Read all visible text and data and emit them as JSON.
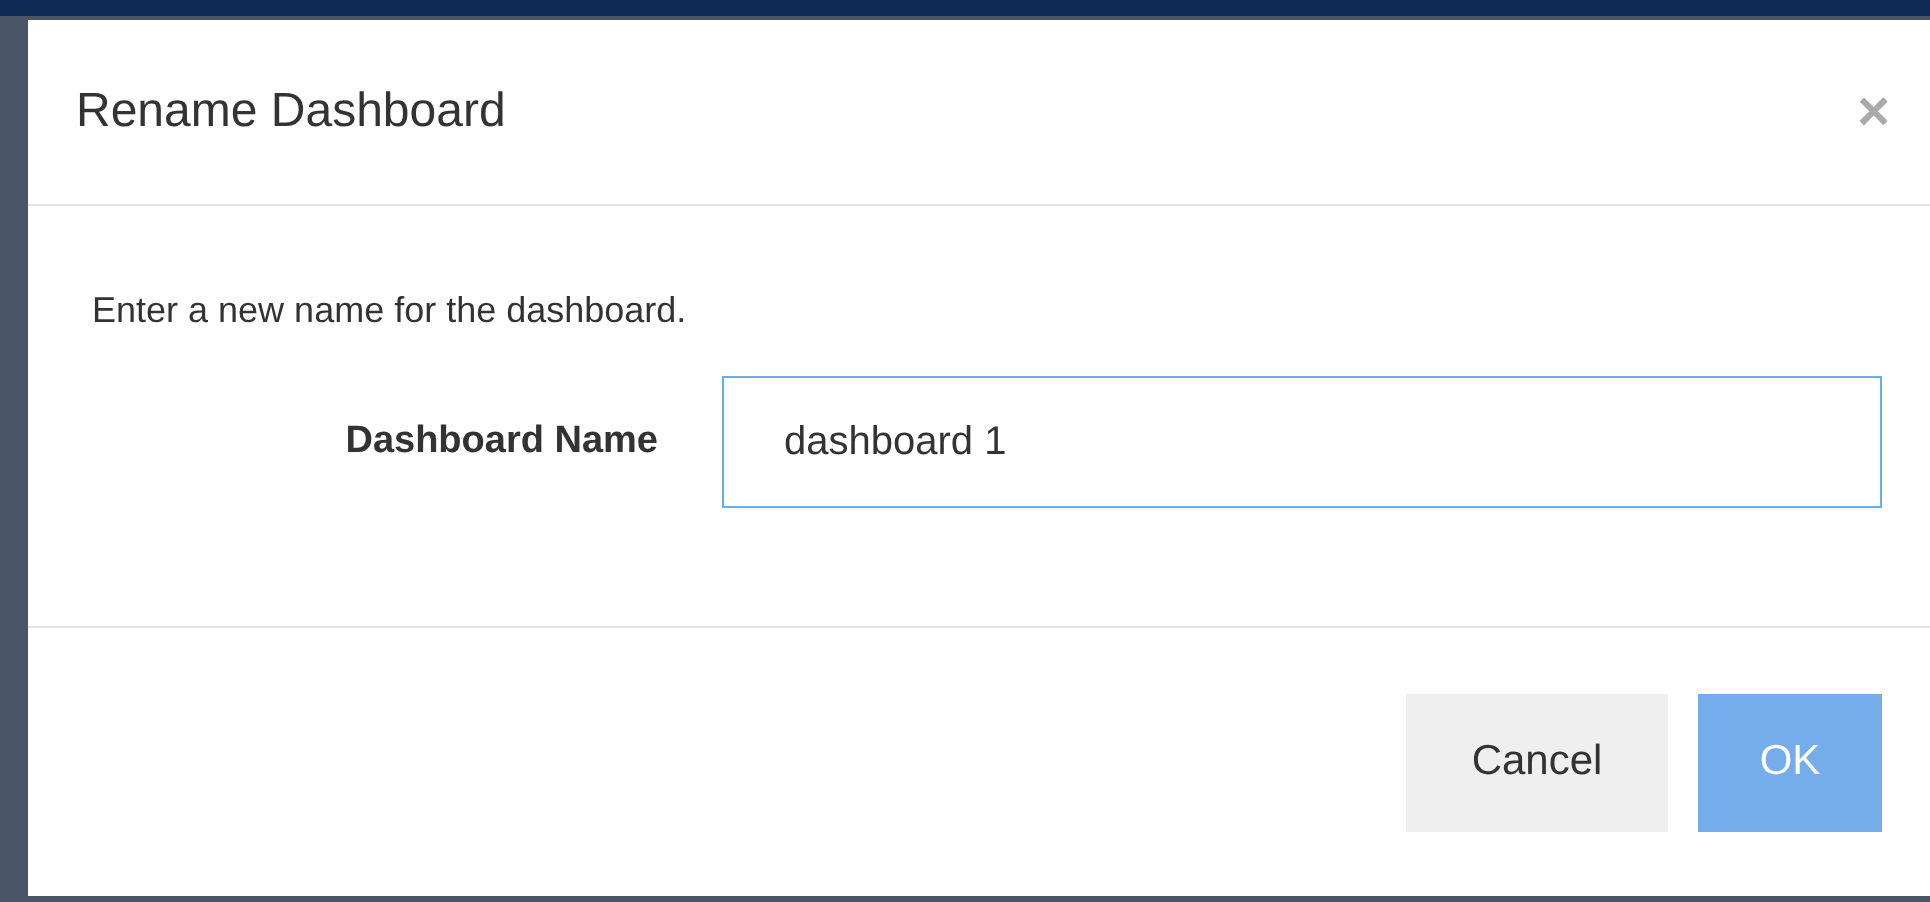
{
  "dialog": {
    "title": "Rename Dashboard",
    "close": "×",
    "message": "Enter a new name for the dashboard.",
    "field": {
      "label": "Dashboard Name",
      "value": "dashboard 1"
    },
    "buttons": [
      {
        "label": "Cancel",
        "kind": "secondary"
      },
      {
        "label": "OK",
        "kind": "primary"
      }
    ]
  }
}
